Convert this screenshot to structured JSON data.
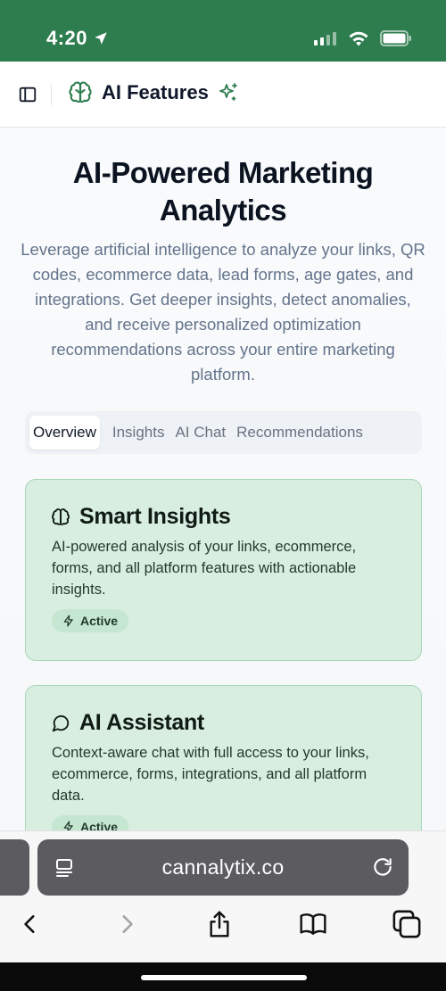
{
  "status_bar": {
    "time": "4:20",
    "bg_color": "#2e7d4f"
  },
  "header": {
    "title": "AI Features",
    "brand_icon": "brain-icon",
    "sparkle_icon": "sparkles-icon"
  },
  "hero": {
    "title": "AI-Powered Marketing Analytics",
    "description": "Leverage artificial intelligence to analyze your links, QR codes, ecommerce data, lead forms, age gates, and integrations. Get deeper insights, detect anomalies, and receive personalized optimization recommendations across your entire marketing platform."
  },
  "tabs": [
    {
      "label": "Overview",
      "active": true
    },
    {
      "label": "Insights",
      "active": false
    },
    {
      "label": "AI Chat",
      "active": false
    },
    {
      "label": "Recommendations",
      "active": false
    }
  ],
  "cards": [
    {
      "icon": "brain-icon",
      "title": "Smart Insights",
      "description": "AI-powered analysis of your links, ecommerce, forms, and all platform features with actionable insights.",
      "badge": "Active"
    },
    {
      "icon": "message-circle-icon",
      "title": "AI Assistant",
      "description": "Context-aware chat with full access to your links, ecommerce, forms, integrations, and all platform data.",
      "badge": "Active"
    }
  ],
  "browser": {
    "url": "cannalytix.co"
  },
  "colors": {
    "accent": "#2e7d4f",
    "card_bg": "#d8eee1",
    "card_border": "#a9d6bb"
  }
}
